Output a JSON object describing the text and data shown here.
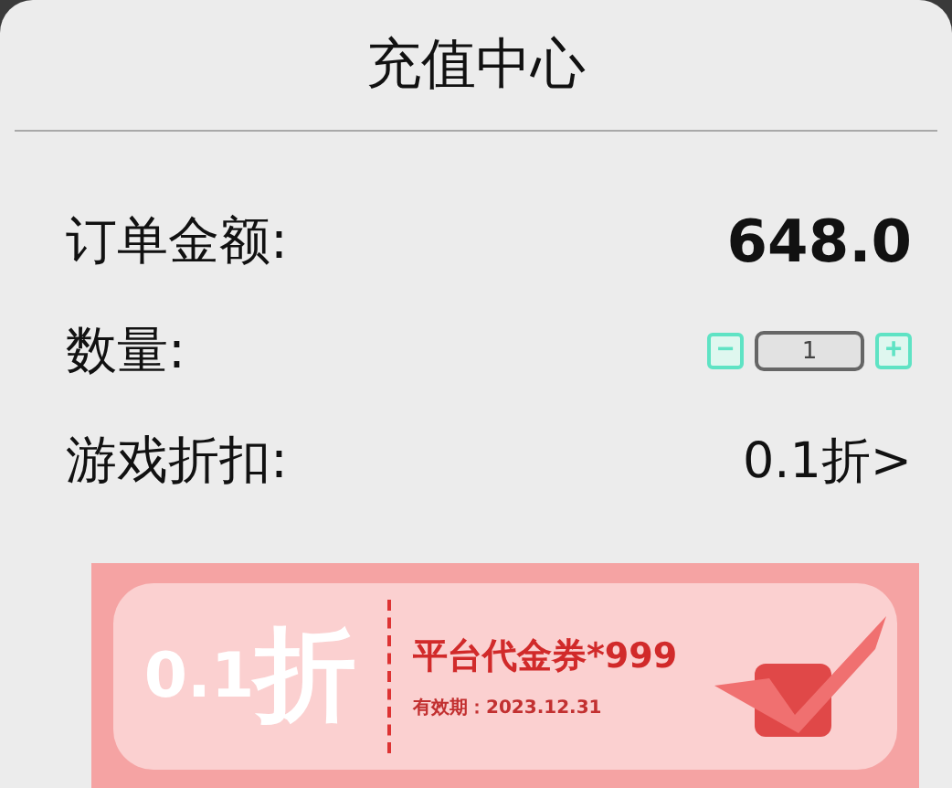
{
  "title": "充值中心",
  "rows": [
    {
      "kind": "text",
      "label": "订单金额:",
      "value": "648.0"
    },
    {
      "kind": "stepper",
      "label": "数量:",
      "value": "1",
      "minus": "−",
      "plus": "+"
    },
    {
      "kind": "link",
      "label": "游戏折扣:",
      "value": "0.1折>"
    }
  ],
  "coupon": {
    "discount": "0.1",
    "discount_unit": "折",
    "name": "平台代金券*999",
    "expiry": "有效期：2023.12.31"
  }
}
